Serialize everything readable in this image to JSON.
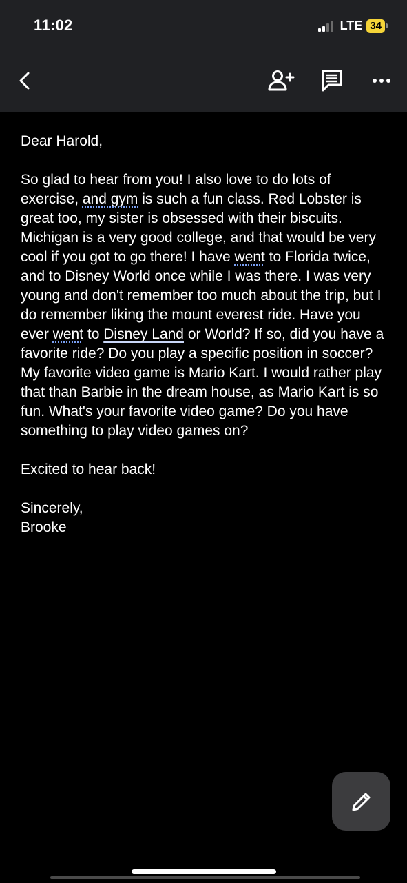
{
  "status_bar": {
    "time": "11:02",
    "network": "LTE",
    "battery_level": "34",
    "battery_color": "#f5d438"
  },
  "toolbar": {
    "back_icon": "chevron-left-icon",
    "add_person_icon": "person-add-icon",
    "comment_icon": "comment-icon",
    "more_icon": "more-horizontal-icon"
  },
  "document": {
    "salutation": "Dear Harold,",
    "body_parts": {
      "p1": "So glad to hear from you! I also love to do lots of exercise, ",
      "and_gym": "and gym",
      "p2": " is such a fun class. Red Lobster is great too, my sister is obsessed with their biscuits. Michigan is a very good college, and that would be very cool if you got to go there! I have ",
      "went1": "went",
      "p3": " to Florida twice, and to Disney World once while I was there. I was very young and don't remember too much about the trip, but I do remember liking the mount everest ride. Have you ever ",
      "went2": "went",
      "p4": " to ",
      "disney_land": "Disney Land",
      "p5": " or World? If so, did you have a favorite ride? Do you play a specific position in soccer? My favorite video game is Mario Kart. I would rather play that than Barbie in the dream house, as Mario Kart is so fun. What's your favorite video game? Do you have something to play video games on?"
    },
    "closing_line": "Excited to hear back!",
    "signoff": "Sincerely,",
    "signature": "Brooke"
  },
  "fab": {
    "icon": "pencil-icon",
    "background": "#3c3c3e"
  }
}
